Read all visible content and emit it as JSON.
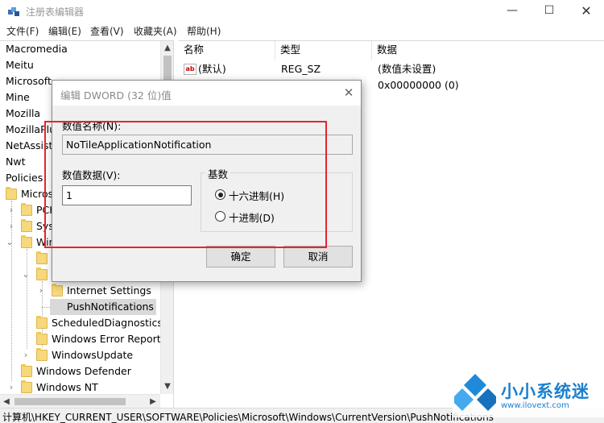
{
  "window": {
    "title": "注册表编辑器",
    "minimize": "—",
    "maximize": "☐",
    "close": "✕"
  },
  "menu": [
    "文件(F)",
    "编辑(E)",
    "查看(V)",
    "收藏夹(A)",
    "帮助(H)"
  ],
  "tree": {
    "items": [
      {
        "label": "Macromedia"
      },
      {
        "label": "Meitu"
      },
      {
        "label": "Microsoft"
      },
      {
        "label": "Mine"
      },
      {
        "label": "Mozilla"
      },
      {
        "label": "MozillaPlu"
      },
      {
        "label": "NetAssista"
      },
      {
        "label": "Nwt"
      },
      {
        "label": "Policies"
      },
      {
        "label": "Micros"
      },
      {
        "label": "PCH"
      },
      {
        "label": "Sys"
      },
      {
        "label": "Win"
      },
      {
        "label": "Internet Settings"
      },
      {
        "label": "PushNotifications"
      },
      {
        "label": "ScheduledDiagnostics"
      },
      {
        "label": "Windows Error Reporti"
      },
      {
        "label": "WindowsUpdate"
      },
      {
        "label": "Windows Defender"
      },
      {
        "label": "Windows NT"
      }
    ]
  },
  "list": {
    "headers": {
      "name": "名称",
      "type": "类型",
      "data": "数据"
    },
    "rows": [
      {
        "name": "(默认)",
        "type": "REG_SZ",
        "data": "(数值未设置)",
        "icon": "string-value-icon"
      },
      {
        "name": "",
        "type": "",
        "data": "0x00000000 (0)",
        "icon": "dword-value-icon"
      }
    ]
  },
  "status": {
    "path": "计算机\\HKEY_CURRENT_USER\\SOFTWARE\\Policies\\Microsoft\\Windows\\CurrentVersion\\PushNotifications"
  },
  "dialog": {
    "title": "编辑 DWORD (32 位)值",
    "name_label": "数值名称(N):",
    "name_value": "NoTileApplicationNotification",
    "data_label": "数值数据(V):",
    "data_value": "1",
    "base_label": "基数",
    "hex_label": "十六进制(H)",
    "dec_label": "十进制(D)",
    "selected_base": "hex",
    "ok_label": "确定",
    "cancel_label": "取消",
    "close": "✕"
  },
  "watermark": {
    "brand": "小小系统迷",
    "url": "www.ilovext.com"
  },
  "colors": {
    "highlight": "#e8242c",
    "brand": "#1a7fd0",
    "folder": "#f7d87a"
  }
}
